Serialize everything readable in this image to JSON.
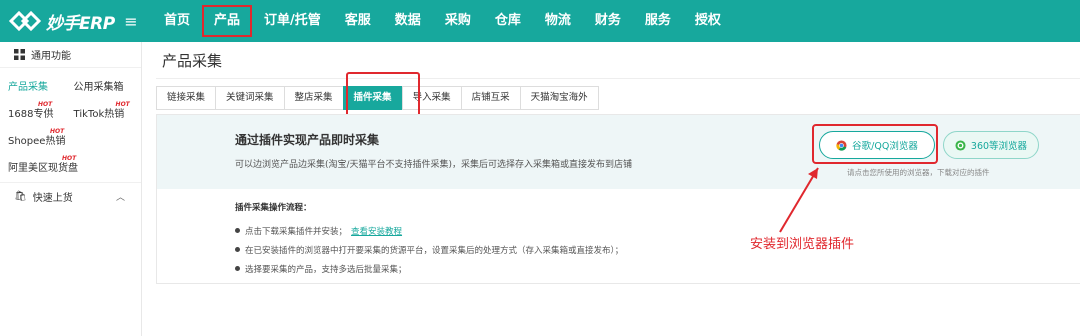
{
  "app": {
    "logo_text": "妙手ERP",
    "menu_icon": "menu-icon"
  },
  "nav": {
    "items": [
      "首页",
      "产品",
      "订单/托管",
      "客服",
      "数据",
      "采购",
      "仓库",
      "物流",
      "财务",
      "服务",
      "授权"
    ],
    "highlighted": "产品"
  },
  "sidebar": {
    "header": "通用功能",
    "rows": [
      {
        "c1": "产品采集",
        "c1_active": true,
        "c2": "公用采集箱"
      },
      {
        "c1": "1688专供",
        "c1_hot": "HOT",
        "c2": "TikTok热销",
        "c2_hot": "HOT"
      },
      {
        "c1": "Shopee热销",
        "c1_hot": "HOT",
        "c2": ""
      },
      {
        "c1": "阿里美区现货盘",
        "c1_hot": "HOT",
        "c2": ""
      }
    ],
    "section": "快速上货"
  },
  "main": {
    "title": "产品采集",
    "tabs": [
      "链接采集",
      "关键词采集",
      "整店采集",
      "插件采集",
      "导入采集",
      "店铺互采",
      "天猫淘宝海外"
    ],
    "active_tab": "插件采集",
    "banner": {
      "title": "通过插件实现产品即时采集",
      "desc": "可以边浏览产品边采集(淘宝/天猫平台不支持插件采集)，采集后可选择存入采集箱或直接发布到店铺",
      "btn_chrome": "谷歌/QQ浏览器",
      "btn_360": "360等浏览器",
      "hint": "请点击您所使用的浏览器，下载对应的插件"
    },
    "steps": {
      "title": "插件采集操作流程：",
      "items": [
        {
          "text": "点击下载采集插件并安装；",
          "link": "查看安装教程"
        },
        {
          "text": "在已安装插件的浏览器中打开要采集的货源平台，设置采集后的处理方式（存入采集箱或直接发布）；"
        },
        {
          "text": "选择要采集的产品，支持多选后批量采集；"
        }
      ]
    }
  },
  "annotation": {
    "text": "安装到浏览器插件"
  },
  "colors": {
    "brand": "#17a89d",
    "highlight": "#e0282e"
  }
}
